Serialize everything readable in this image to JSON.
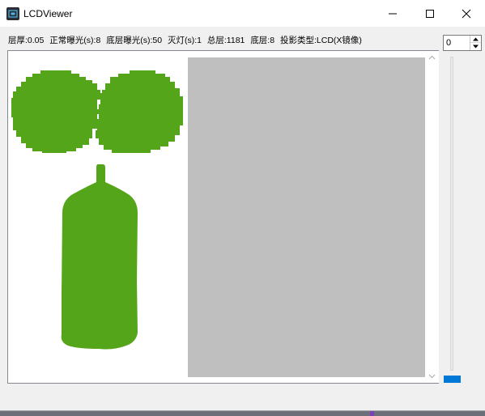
{
  "window": {
    "title": "LCDViewer",
    "icon": "app-icon",
    "controls": [
      "minimize-icon",
      "maximize-icon",
      "close-icon"
    ]
  },
  "status": {
    "layer_thickness": "层厚:0.05",
    "normal_exposure": "正常曝光(s):8",
    "bottom_exposure": "底层曝光(s):50",
    "light_off": "灭灯(s):1",
    "total_layers": "总层:1181",
    "bottom_layers": "底层:8",
    "projection_type": "投影类型:LCD(X镜像)"
  },
  "layer_spinner": {
    "value": "0"
  },
  "layer_slider": {
    "position": 0
  },
  "colors": {
    "model": "#55a51a",
    "build_area": "#bfbfbf",
    "accent": "#0078d7"
  }
}
